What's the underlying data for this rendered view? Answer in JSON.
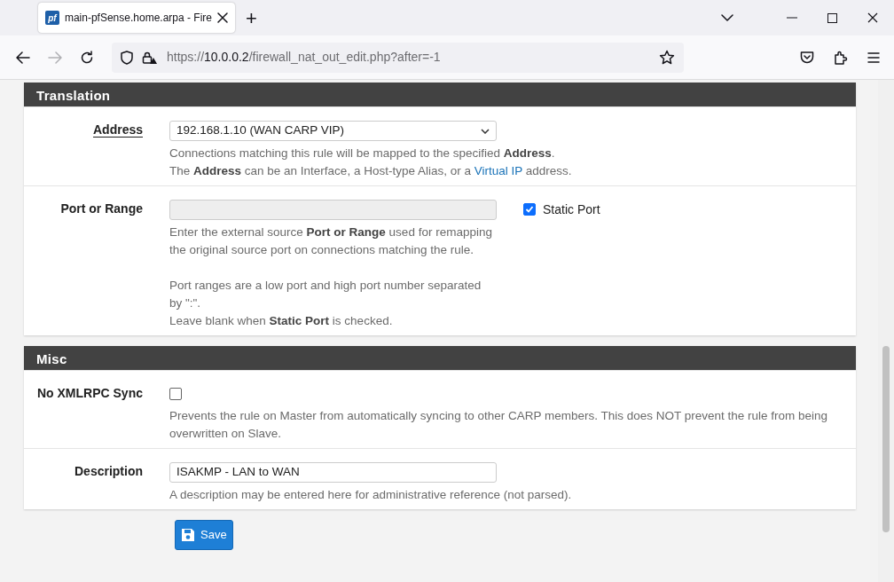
{
  "browser": {
    "tab_title": "main-pfSense.home.arpa - Fire",
    "favicon_text": "pf",
    "new_tab": "+",
    "url": {
      "scheme": "https://",
      "host": "10.0.0.2",
      "path": "/firewall_nat_out_edit.php?after=-1"
    }
  },
  "sections": [
    {
      "title": "Translation",
      "rows": [
        {
          "kind": "select",
          "label": "Address",
          "label_link": true,
          "value": "192.168.1.10 (WAN CARP VIP)",
          "help": [
            [
              "Connections matching this rule will be mapped to the specified **Address**.",
              {
                "text": "The **Address** can be an Interface, a Host-type Alias, or a ",
                "link": "Virtual IP",
                "after": " address."
              }
            ]
          ]
        },
        {
          "kind": "input_checkbox",
          "label": "Port or Range",
          "label_link": false,
          "value": "",
          "disabled": true,
          "checkbox_label": "Static Port",
          "checked": true,
          "help": [
            [
              "Enter the external source **Port or Range** used for remapping the original source port on connections matching the rule."
            ],
            [
              "Port ranges are a low port and high port number separated by \":\".",
              "Leave blank when **Static Port** is checked."
            ]
          ]
        }
      ]
    },
    {
      "title": "Misc",
      "rows": [
        {
          "kind": "checkbox",
          "label": "No XMLRPC Sync",
          "label_link": false,
          "checked": false,
          "help": [
            [
              "Prevents the rule on Master from automatically syncing to other CARP members. This does NOT prevent the rule from being overwritten on Slave."
            ]
          ]
        },
        {
          "kind": "input",
          "label": "Description",
          "label_link": false,
          "value": "ISAKMP - LAN to WAN",
          "disabled": false,
          "help": [
            [
              "A description may be entered here for administrative reference (not parsed)."
            ]
          ]
        }
      ]
    }
  ],
  "save_button": "Save"
}
